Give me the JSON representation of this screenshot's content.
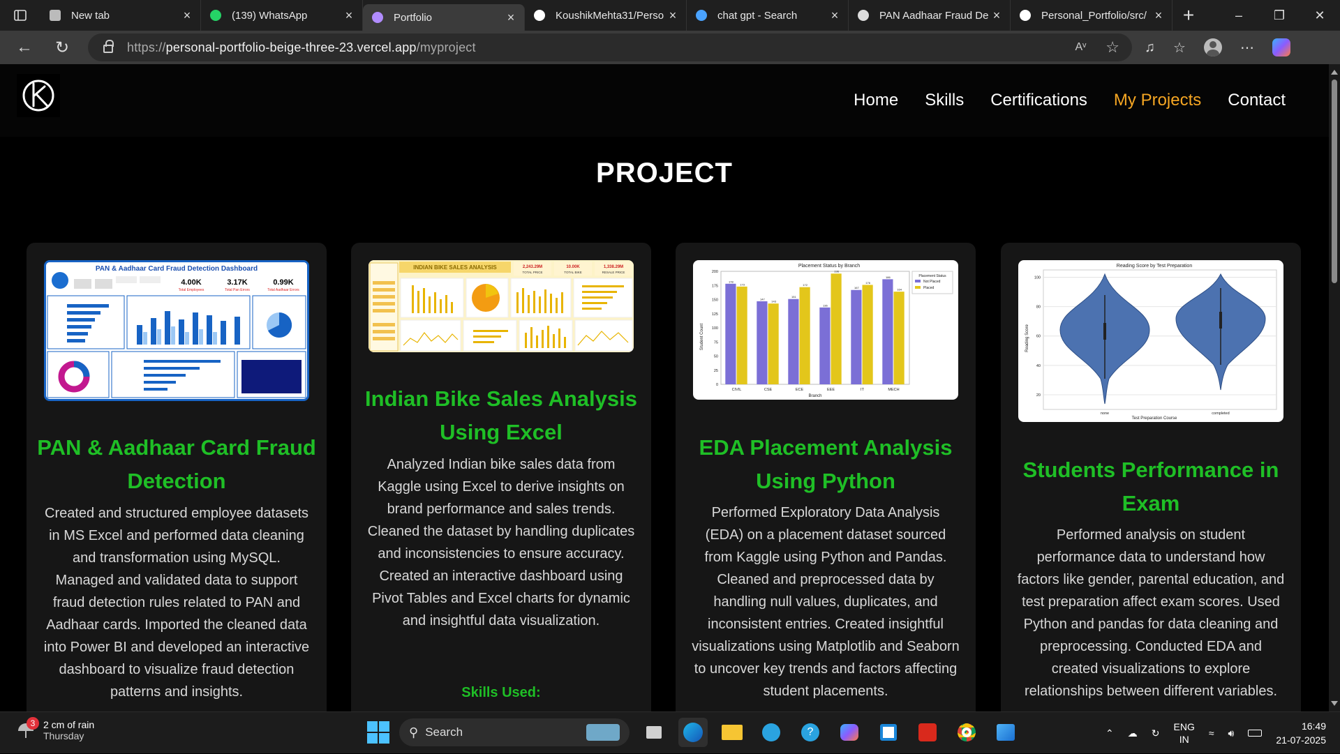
{
  "browser": {
    "tabs": [
      {
        "title": "New tab",
        "icon": "newtab-icon"
      },
      {
        "title": "(139) WhatsApp",
        "icon": "whatsapp-icon"
      },
      {
        "title": "Portfolio",
        "icon": "vercel-icon",
        "active": true
      },
      {
        "title": "KoushikMehta31/Perso",
        "icon": "github-icon"
      },
      {
        "title": "chat gpt - Search",
        "icon": "bing-search-icon"
      },
      {
        "title": "PAN Aadhaar Fraud De",
        "icon": "chatgpt-icon"
      },
      {
        "title": "Personal_Portfolio/src/",
        "icon": "github-icon"
      }
    ],
    "url_scheme": "https://",
    "url_host": "personal-portfolio-beige-three-23.vercel.app",
    "url_path": "/myproject"
  },
  "site": {
    "nav": [
      "Home",
      "Skills",
      "Certifications",
      "My Projects",
      "Contact"
    ],
    "active_nav": "My Projects",
    "section_title": "PROJECT",
    "accent_color": "#1fbf26",
    "nav_active_color": "#f5a623"
  },
  "projects": [
    {
      "title": "PAN & Aadhaar Card Fraud Detection",
      "description": "Created and structured employee datasets in MS Excel and performed data cleaning and transformation using MySQL. Managed and validated data to support fraud detection rules related to PAN and Aadhaar cards. Imported the cleaned data into Power BI and developed an interactive dashboard to visualize fraud detection patterns and insights.",
      "thumb": {
        "title": "PAN & Aadhaar Card Fraud Detection Dashboard",
        "kpi1_value": "4.00K",
        "kpi1_label": "Total Employees",
        "kpi2_value": "3.17K",
        "kpi2_label": "Total Pan Errors",
        "kpi3_value": "0.99K",
        "kpi3_label": "Total Aadhaar Errors"
      }
    },
    {
      "title": "Indian Bike Sales Analysis Using Excel",
      "description": "Analyzed Indian bike sales data from Kaggle using Excel to derive insights on brand performance and sales trends. Cleaned the dataset by handling duplicates and inconsistencies to ensure accuracy. Created an interactive dashboard using Pivot Tables and Excel charts for dynamic and insightful data visualization.",
      "skills_label": "Skills Used:",
      "thumb": {
        "title": "INDIAN BIKE SALES ANALYSIS",
        "kpi1_value": "2,243.29M",
        "kpi1_label": "TOTAL PRICE",
        "kpi2_value": "10.00K",
        "kpi2_label": "TOTAL BIKE",
        "kpi3_value": "1,338.29M",
        "kpi3_label": "RESALE PRICE"
      }
    },
    {
      "title": "EDA Placement Analysis Using Python",
      "description": "Performed Exploratory Data Analysis (EDA) on a placement dataset sourced from Kaggle using Python and Pandas. Cleaned and preprocessed data by handling null values, duplicates, and inconsistent entries. Created insightful visualizations using Matplotlib and Seaborn to uncover key trends and factors affecting student placements.",
      "thumb": {
        "title": "Placement Status by Branch",
        "ylabel": "Student Count",
        "xlabel": "Branch",
        "legend_title": "Placement Status",
        "legend": [
          "Not Placed",
          "Placed"
        ]
      }
    },
    {
      "title": "Students Performance in Exam",
      "description": "Performed analysis on student performance data to understand how factors like gender, parental education, and test preparation affect exam scores. Used Python and pandas for data cleaning and preprocessing. Conducted EDA and created visualizations to explore relationships between different variables.",
      "thumb": {
        "title": "Reading Score by Test Preparation",
        "ylabel": "Reading Score",
        "xlabel": "Test Preparation Course",
        "categories": [
          "none",
          "completed"
        ]
      }
    }
  ],
  "chart_data": {
    "type": "bar",
    "title": "Placement Status by Branch",
    "xlabel": "Branch",
    "ylabel": "Student Count",
    "categories": [
      "CIVIL",
      "CSE",
      "ECE",
      "EEE",
      "IT",
      "MECH"
    ],
    "series": [
      {
        "name": "Not Placed",
        "values": [
          178,
          147,
          151,
          136,
          167,
          186
        ],
        "color": "#7b6fd6"
      },
      {
        "name": "Placed",
        "values": [
          173,
          143,
          172,
          196,
          176,
          164
        ],
        "color": "#e3c61b"
      }
    ],
    "ylim": [
      0,
      200
    ],
    "yticks": [
      0,
      25,
      50,
      75,
      100,
      125,
      150,
      175,
      200
    ]
  },
  "violin": {
    "yticks": [
      20,
      40,
      60,
      80,
      100
    ],
    "ylim": [
      10,
      105
    ]
  },
  "taskbar": {
    "weather_main": "2 cm of rain",
    "weather_day": "Thursday",
    "weather_badge": "3",
    "search": "Search",
    "lang1": "ENG",
    "lang2": "IN",
    "time": "16:49",
    "date": "21-07-2025"
  }
}
